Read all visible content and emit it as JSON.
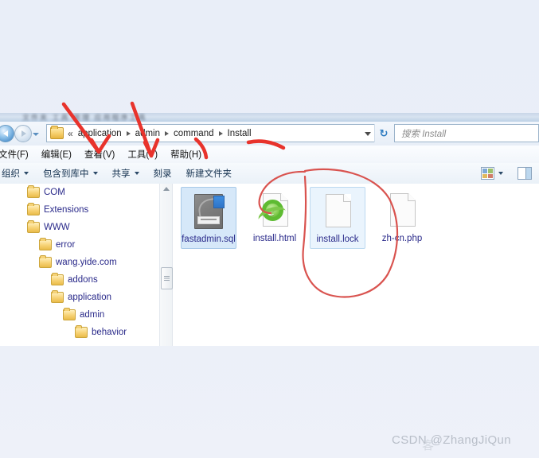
{
  "window": {
    "title_strip_blurred": "文件夹 工具 管理 应用程序工具"
  },
  "address_bar": {
    "back_icon": "back-arrow-icon",
    "forward_icon": "forward-arrow-icon",
    "history_caret": "chevron-down-icon",
    "folder_icon": "folder-icon",
    "overflow_chevron": "«",
    "crumbs": [
      "application",
      "admin",
      "command",
      "Install"
    ],
    "dropdown_caret": "chevron-down-icon",
    "refresh_icon": "refresh-icon",
    "refresh_glyph": "↻"
  },
  "search": {
    "placeholder": "搜索 Install",
    "value": ""
  },
  "menu_bar": {
    "items": [
      {
        "label": "文件(F)"
      },
      {
        "label": "编辑(E)"
      },
      {
        "label": "查看(V)"
      },
      {
        "label": "工具(T)"
      },
      {
        "label": "帮助(H)"
      }
    ]
  },
  "command_bar": {
    "items": [
      {
        "label": "组织",
        "caret": true
      },
      {
        "label": "包含到库中",
        "caret": true
      },
      {
        "label": "共享",
        "caret": true
      },
      {
        "label": "刻录",
        "caret": false
      },
      {
        "label": "新建文件夹",
        "caret": false
      }
    ],
    "view_button": "views-icon",
    "view_caret": "chevron-down-icon",
    "preview_pane_button": "preview-pane-icon"
  },
  "nav_pane": {
    "tree": [
      {
        "label": "COM",
        "indent": 0
      },
      {
        "label": "Extensions",
        "indent": 0
      },
      {
        "label": "WWW",
        "indent": 0
      },
      {
        "label": "error",
        "indent": 1
      },
      {
        "label": "wang.yide.com",
        "indent": 1
      },
      {
        "label": "addons",
        "indent": 2
      },
      {
        "label": "application",
        "indent": 2
      },
      {
        "label": "admin",
        "indent": 3
      },
      {
        "label": "behavior",
        "indent": 4
      }
    ],
    "scrollbar": {
      "up_arrow": "scroll-up-arrow-icon",
      "thumb": "scrollbar-thumb"
    }
  },
  "file_pane": {
    "files": [
      {
        "name": "fastadmin.sql",
        "icon": "sql-file-icon",
        "state": "selected"
      },
      {
        "name": "install.html",
        "icon": "ie-html-file-icon",
        "state": "normal"
      },
      {
        "name": "install.lock",
        "icon": "generic-file-icon",
        "state": "hover"
      },
      {
        "name": "zh-cn.php",
        "icon": "generic-file-icon",
        "state": "normal"
      }
    ]
  },
  "annotations": {
    "ink_color": "#e8332c",
    "circle_color": "#d9534f",
    "marks": [
      {
        "kind": "arrow",
        "target": "查看(V)"
      },
      {
        "kind": "arrow",
        "target": "共享"
      },
      {
        "kind": "stroke",
        "target": "command"
      },
      {
        "kind": "stroke",
        "target": "Install"
      },
      {
        "kind": "circle",
        "target": "install.lock"
      }
    ]
  },
  "watermark": {
    "text": "CSDN @ZhangJiQun",
    "ghost": "客"
  }
}
